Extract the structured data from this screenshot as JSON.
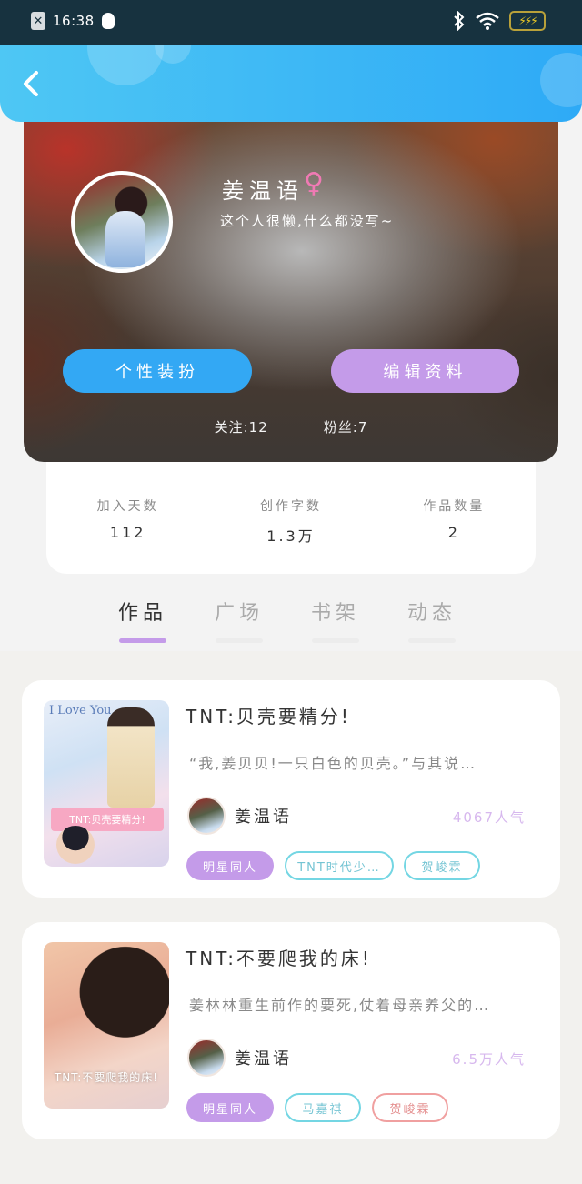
{
  "status_bar": {
    "time": "16:38",
    "notif_icon": "x-app-icon",
    "qq_icon": "penguin-icon",
    "battery_glyph": "⚡⚡⚡"
  },
  "header": {
    "back_icon": "chevron-left-icon"
  },
  "profile": {
    "name": "姜温语",
    "gender_symbol": "♀",
    "bio": "这个人很懒,什么都没写~",
    "buttons": {
      "style": "个性装扮",
      "edit": "编辑资料"
    },
    "follow": "关注:12",
    "fans": "粉丝:7"
  },
  "stats": [
    {
      "label": "加入天数",
      "value": "112"
    },
    {
      "label": "创作字数",
      "value": "1.3万"
    },
    {
      "label": "作品数量",
      "value": "2"
    }
  ],
  "tabs": [
    {
      "label": "作品",
      "active": true
    },
    {
      "label": "广场",
      "active": false
    },
    {
      "label": "书架",
      "active": false
    },
    {
      "label": "动态",
      "active": false
    }
  ],
  "works": [
    {
      "title": "TNT:贝壳要精分!",
      "description": "“我,姜贝贝!一只白色的贝壳。”与其说…",
      "author": "姜温语",
      "popularity": "4067人气",
      "cover_text": "I Love You.",
      "cover_banner": "TNT:贝壳要精分!",
      "tags": [
        {
          "label": "明星同人",
          "style": "purple"
        },
        {
          "label": "TNT时代少…",
          "style": "cyan"
        },
        {
          "label": "贺峻霖",
          "style": "cyan"
        }
      ]
    },
    {
      "title": "TNT:不要爬我的床!",
      "description": "姜林林重生前作的要死,仗着母亲养父的…",
      "author": "姜温语",
      "popularity": "6.5万人气",
      "cover_caption": "TNT:不要爬我的床!",
      "tags": [
        {
          "label": "明星同人",
          "style": "purple"
        },
        {
          "label": "马嘉祺",
          "style": "cyan"
        },
        {
          "label": "贺峻霖",
          "style": "red"
        }
      ]
    }
  ],
  "colors": {
    "header": "#2eaaf6",
    "accent_blue": "#33a8f4",
    "accent_purple": "#c49be9",
    "tag_cyan": "#74d6e3",
    "tag_red": "#f0a0a0"
  }
}
